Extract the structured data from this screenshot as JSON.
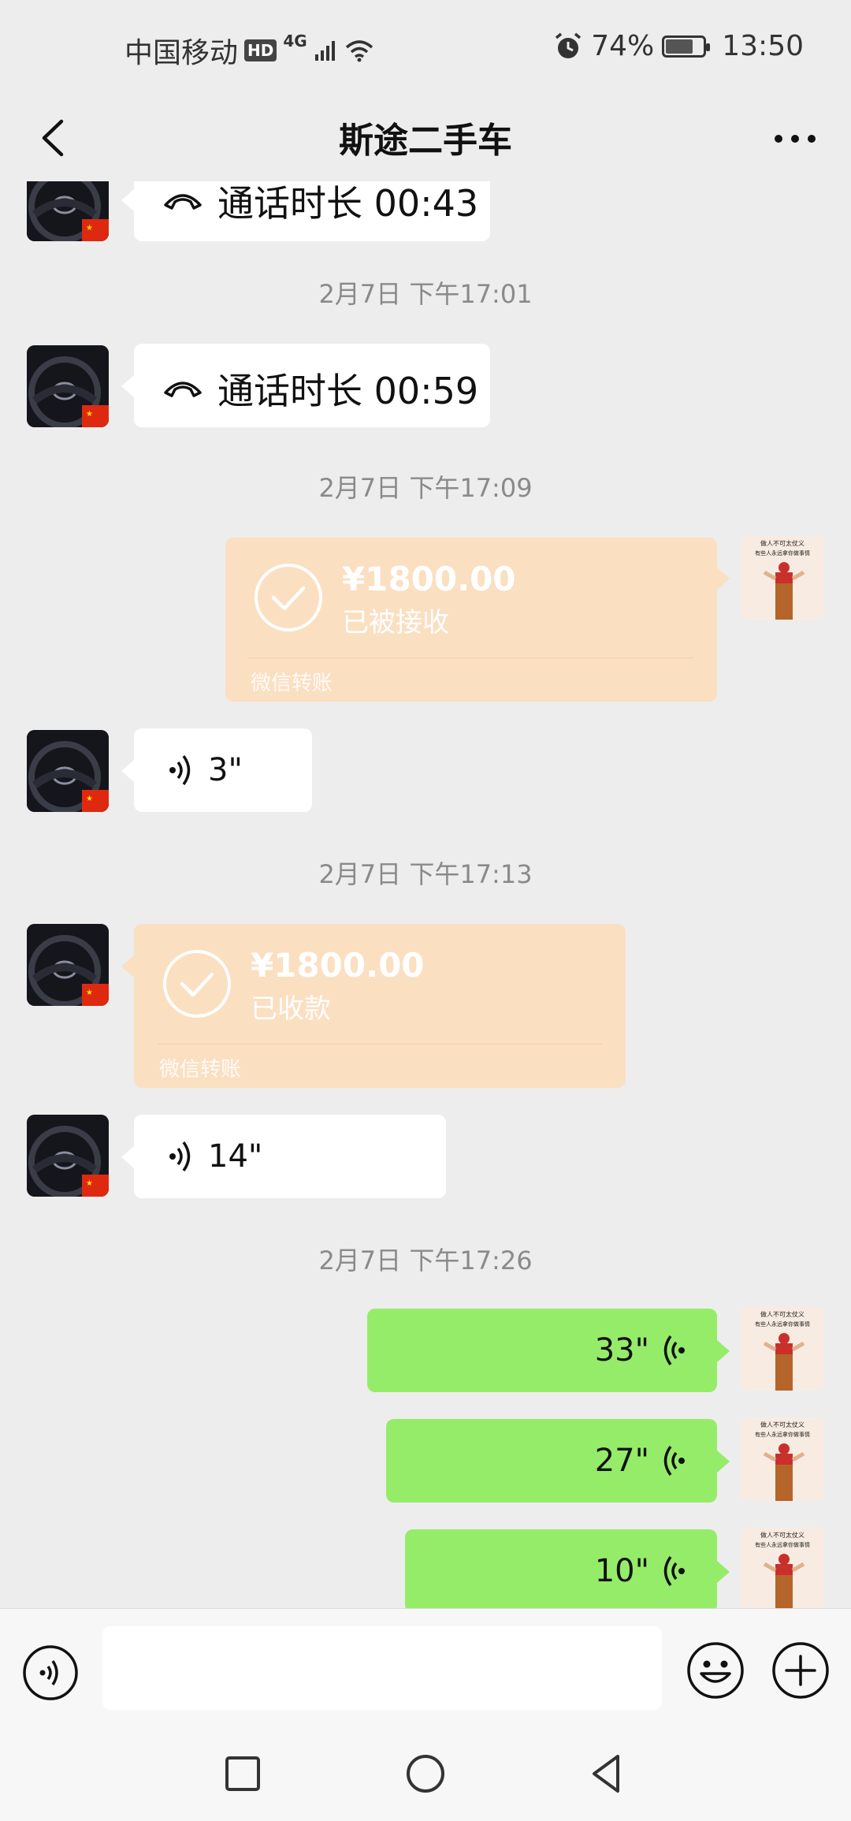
{
  "status_bar": {
    "carrier": "中国移动",
    "hd": "HD",
    "network": "4G",
    "battery": "74%",
    "battery_level": 0.74,
    "time": "13:50"
  },
  "header": {
    "title": "斯途二手车"
  },
  "messages": [
    {
      "type": "call",
      "side": "other",
      "text": "通话时长 00:43"
    },
    {
      "type": "time",
      "text": "2月7日 下午17:01"
    },
    {
      "type": "call",
      "side": "other",
      "text": "通话时长 00:59"
    },
    {
      "type": "time",
      "text": "2月7日 下午17:09"
    },
    {
      "type": "transfer",
      "side": "self",
      "amount": "¥1800.00",
      "status": "已被接收",
      "label": "微信转账"
    },
    {
      "type": "voice",
      "side": "other",
      "duration": "3\""
    },
    {
      "type": "time",
      "text": "2月7日 下午17:13"
    },
    {
      "type": "transfer",
      "side": "other",
      "amount": "¥1800.00",
      "status": "已收款",
      "label": "微信转账"
    },
    {
      "type": "voice",
      "side": "other",
      "duration": "14\""
    },
    {
      "type": "time",
      "text": "2月7日 下午17:26"
    },
    {
      "type": "voice",
      "side": "self",
      "duration": "33\""
    },
    {
      "type": "voice",
      "side": "self",
      "duration": "27\""
    },
    {
      "type": "voice",
      "side": "self",
      "duration": "10\""
    }
  ],
  "avatar_self_text": [
    "做人不可太仗义",
    "有些人永远拿你做事情"
  ],
  "colors": {
    "background": "#ededed",
    "self_bubble": "#95ec69",
    "other_bubble": "#ffffff",
    "transfer_bubble": "#fbdfc1",
    "timestamp": "#8a8a8a"
  },
  "icons": {
    "back": "chevron-left-icon",
    "more": "more-icon",
    "voice_input": "voice-icon",
    "emoji": "emoji-icon",
    "plus": "plus-icon",
    "call": "phone-hangup-icon",
    "transfer": "check-circle-icon",
    "sys_recent": "square-icon",
    "sys_home": "circle-icon",
    "sys_back": "triangle-icon"
  }
}
